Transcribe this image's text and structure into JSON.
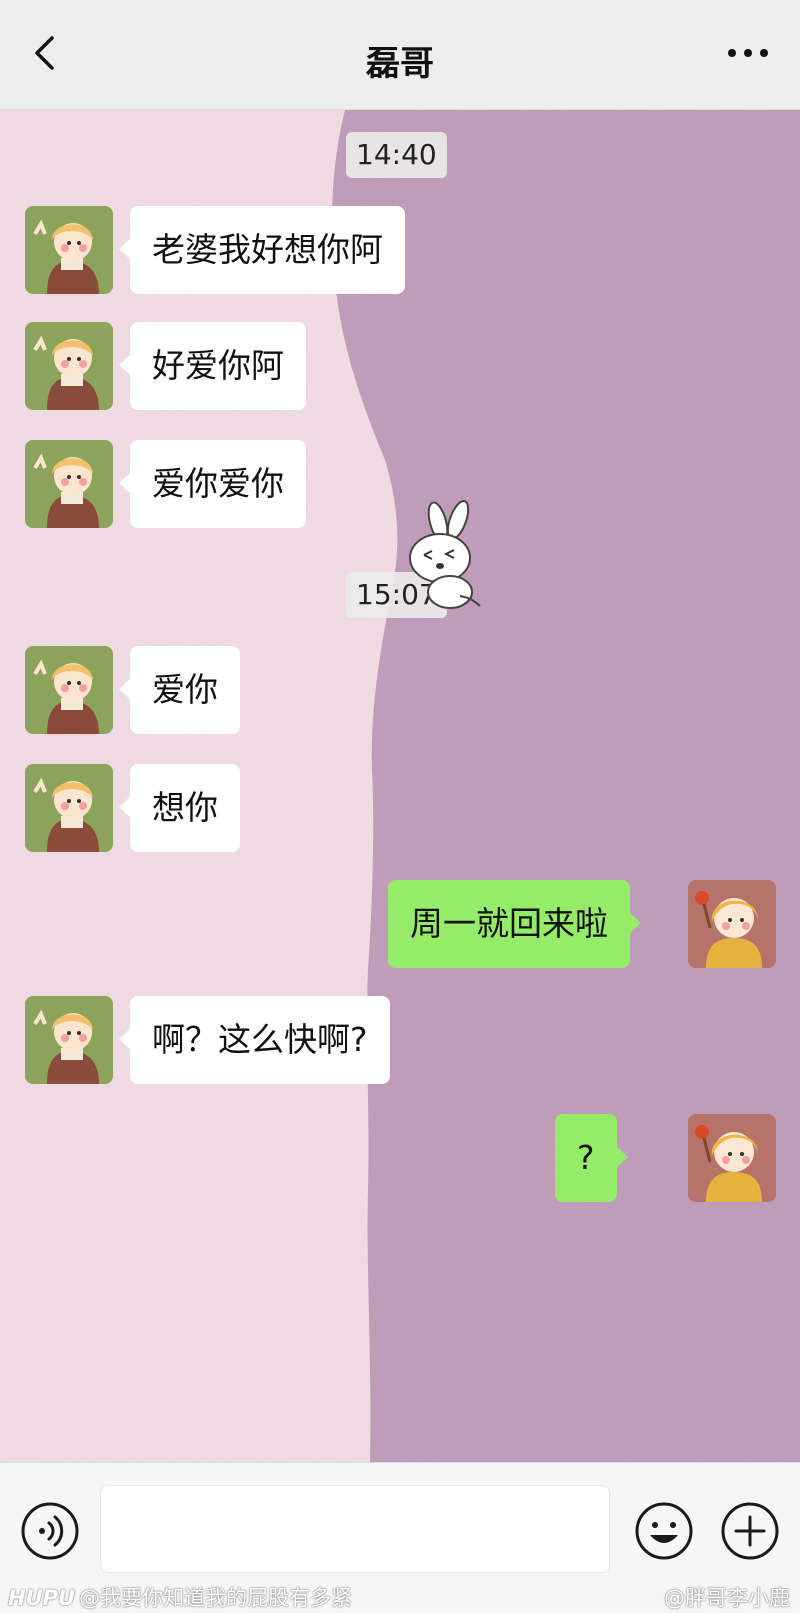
{
  "header": {
    "title": "磊哥",
    "back_icon": "chevron-left-icon",
    "more_icon": "more-dots-icon"
  },
  "timestamps": [
    "14:40",
    "15:07"
  ],
  "messages": [
    {
      "side": "left",
      "text": "老婆我好想你阿"
    },
    {
      "side": "left",
      "text": "好爱你阿"
    },
    {
      "side": "left",
      "text": "爱你爱你"
    },
    {
      "side": "left",
      "text": "爱你"
    },
    {
      "side": "left",
      "text": "想你"
    },
    {
      "side": "right",
      "text": "周一就回来啦"
    },
    {
      "side": "left",
      "text": "啊？这么快啊?"
    },
    {
      "side": "right",
      "text": "?"
    }
  ],
  "input": {
    "value": ""
  },
  "watermarks": {
    "brand": "HUPU",
    "left": "@我要你知道我的屁股有多紧",
    "right": "@胖哥李小鹿"
  },
  "colors": {
    "my_bubble": "#95ec69",
    "their_bubble": "#ffffff",
    "bg_light": "#f4dde8",
    "bg_purple": "#bf9ab9"
  }
}
